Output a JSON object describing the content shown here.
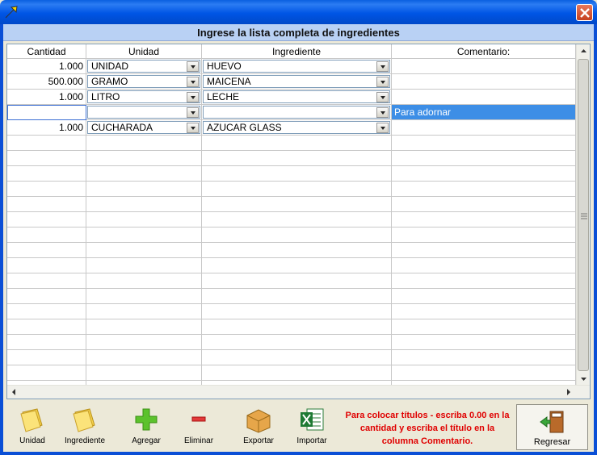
{
  "window": {
    "title": "",
    "header": "Ingrese la lista completa de ingredientes"
  },
  "grid": {
    "columns": [
      "Cantidad",
      "Unidad",
      "Ingrediente",
      "Comentario:"
    ],
    "rows": [
      {
        "cantidad": "1.000",
        "unidad": "UNIDAD",
        "ingrediente": "HUEVO",
        "comentario": ""
      },
      {
        "cantidad": "500.000",
        "unidad": "GRAMO",
        "ingrediente": "MAICENA",
        "comentario": ""
      },
      {
        "cantidad": "1.000",
        "unidad": "LITRO",
        "ingrediente": "LECHE",
        "comentario": ""
      },
      {
        "cantidad": "",
        "unidad": "",
        "ingrediente": "",
        "comentario": "Para adornar"
      },
      {
        "cantidad": "1.000",
        "unidad": "CUCHARADA",
        "ingrediente": "AZUCAR GLASS",
        "comentario": ""
      }
    ],
    "selected_row": 3,
    "empty_rows": 17
  },
  "toolbar": {
    "unidad": "Unidad",
    "ingrediente": "Ingrediente",
    "agregar": "Agregar",
    "eliminar": "Eliminar",
    "exportar": "Exportar",
    "importar": "Importar",
    "regresar": "Regresar",
    "hint": "Para colocar títulos - escriba 0.00 en la cantidad y escriba el título en la columna Comentario."
  },
  "colors": {
    "titlebar": "#0055e5",
    "header_bg": "#b9d1f4",
    "selection": "#3d8ee6",
    "hint_text": "#e00000"
  }
}
